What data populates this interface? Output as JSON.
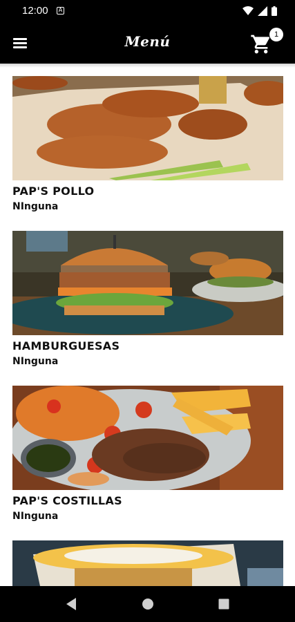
{
  "status": {
    "time": "12:00"
  },
  "header": {
    "title": "Menú",
    "cart_count": "1"
  },
  "items": [
    {
      "title": "PAP'S POLLO",
      "subtitle": "NInguna",
      "image": "fried-chicken-wings"
    },
    {
      "title": "HAMBURGUESAS",
      "subtitle": "NInguna",
      "image": "burger"
    },
    {
      "title": "PAP'S COSTILLAS",
      "subtitle": "NInguna",
      "image": "ribs-shrimp-fries"
    },
    {
      "title": "",
      "subtitle": "",
      "image": "loaded-fries"
    }
  ],
  "icons": {
    "menu": "hamburger-menu-icon",
    "cart": "shopping-cart-icon",
    "back": "back-triangle-icon",
    "home": "home-circle-icon",
    "recents": "recents-square-icon"
  }
}
